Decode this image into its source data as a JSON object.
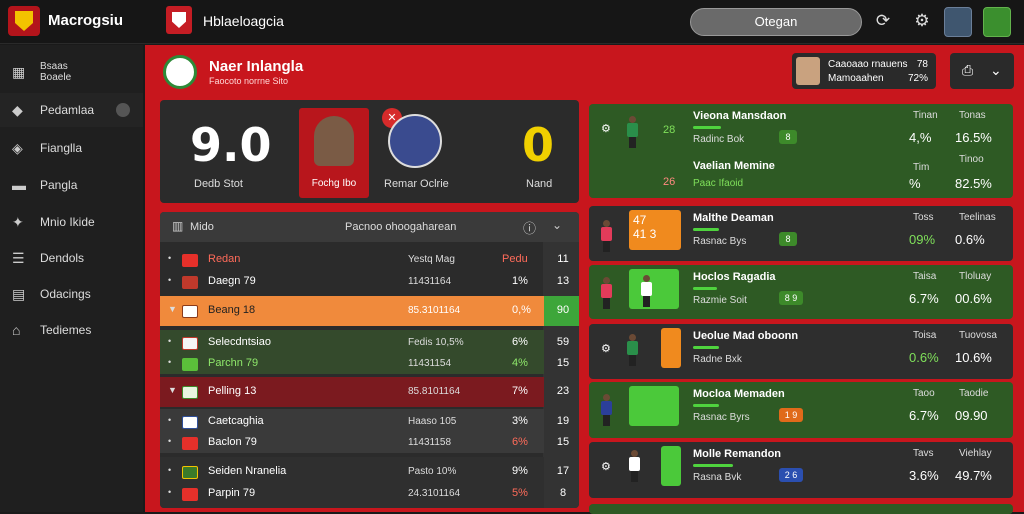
{
  "topbar": {
    "brand": "Mаcrogsiu",
    "sub_brand": "Hblaeloagcia",
    "search_button": "Otegan"
  },
  "sidebar": {
    "items": [
      {
        "label": "Bsaas\nBoaele"
      },
      {
        "label": "Pedamlaa"
      },
      {
        "label": "Fianglla"
      },
      {
        "label": "Pangla"
      },
      {
        "label": "Mnio Ikide"
      },
      {
        "label": "Dendols"
      },
      {
        "label": "Odacings"
      },
      {
        "label": "Tediemes"
      }
    ]
  },
  "header": {
    "title": "Naer Inlangla",
    "subtitle": "Faocoto norrne Sito"
  },
  "profile": {
    "line1": "Caaoaao rnauens",
    "line2": "Mamoaahen",
    "right1": "78",
    "right2": "72%"
  },
  "scoreboard": {
    "home_score": "9.0",
    "home_label": "Dedb Stot",
    "player1_label": "Fochg Ibo",
    "player2_label": "Remar Oclrie",
    "away_score": "0",
    "away_label": "Nand"
  },
  "table": {
    "header_left": "Mido",
    "header_center": "Pacnoo ohoogaharean",
    "rows": [
      {
        "name": "Redan",
        "mid": "Yestq Mag",
        "pct": "Pedu",
        "rt": "11"
      },
      {
        "name": "Daegn 79",
        "mid": "11431164",
        "pct": "1%",
        "rt": "13"
      },
      {
        "name": "Beang 18",
        "mid": "85.3101164",
        "pct": "0,%",
        "rt": "90"
      },
      {
        "name": "Selecdntsiao",
        "mid": "Fedis 10,5%",
        "pct": "6%",
        "rt": "59"
      },
      {
        "name": "Parchn 79",
        "mid": "11431154",
        "pct": "4%",
        "rt": "15"
      },
      {
        "name": "Pelling 13",
        "mid": "85.8101164",
        "pct": "7%",
        "rt": "23"
      },
      {
        "name": "Caetcaghia",
        "mid": "Haaso 105",
        "pct": "3%",
        "rt": "19"
      },
      {
        "name": "Baclon 79",
        "mid": "11431158",
        "pct": "6%",
        "rt": "15"
      },
      {
        "name": "Seiden Nranelia",
        "mid": "Pasto 10%",
        "pct": "9%",
        "rt": "17"
      },
      {
        "name": "Parpin 79",
        "mid": "24.3101164",
        "pct": "5%",
        "rt": "8"
      }
    ]
  },
  "matches": [
    {
      "title": "Vieona Mansdaon",
      "sub": "Radinc Bok",
      "score1": "28",
      "score2": "26",
      "extra": "Paac Ifaoid",
      "title2": "Vaelian Memine",
      "h1": "Tinan",
      "h2": "Tonas",
      "v1": "4,%",
      "v2": "16.5%",
      "h1b": "Tim",
      "h2b": "Tinoo",
      "v1b": "%",
      "v2b": "82.5%"
    },
    {
      "title": "Malthe Deaman",
      "sub": "Rasnac Bys",
      "score1": "47",
      "score2": "41 3",
      "h1": "Toss",
      "h2": "Teelinas",
      "v1": "09%",
      "v2": "0.6%"
    },
    {
      "title": "Hoclos Ragadia",
      "sub": "Razmie Soit",
      "h1": "Taisa",
      "h2": "Tloluay",
      "v1": "6.7%",
      "v2": "00.6%"
    },
    {
      "title": "Ueolue Mad oboonn",
      "sub": "Radne Bxk",
      "h1": "Toisa",
      "h2": "Tuovosa",
      "v1": "0.6%",
      "v2": "10.6%"
    },
    {
      "title": "Mocloa Memaden",
      "sub": "Rasnac Byrs",
      "h1": "Taoo",
      "h2": "Taodie",
      "v1": "6.7%",
      "v2": "09.90"
    },
    {
      "title": "Molle Remandon",
      "sub": "Rasna Bvk",
      "h1": "Tavs",
      "h2": "Viehlay",
      "v1": "3.6%",
      "v2": "49.7%"
    }
  ]
}
